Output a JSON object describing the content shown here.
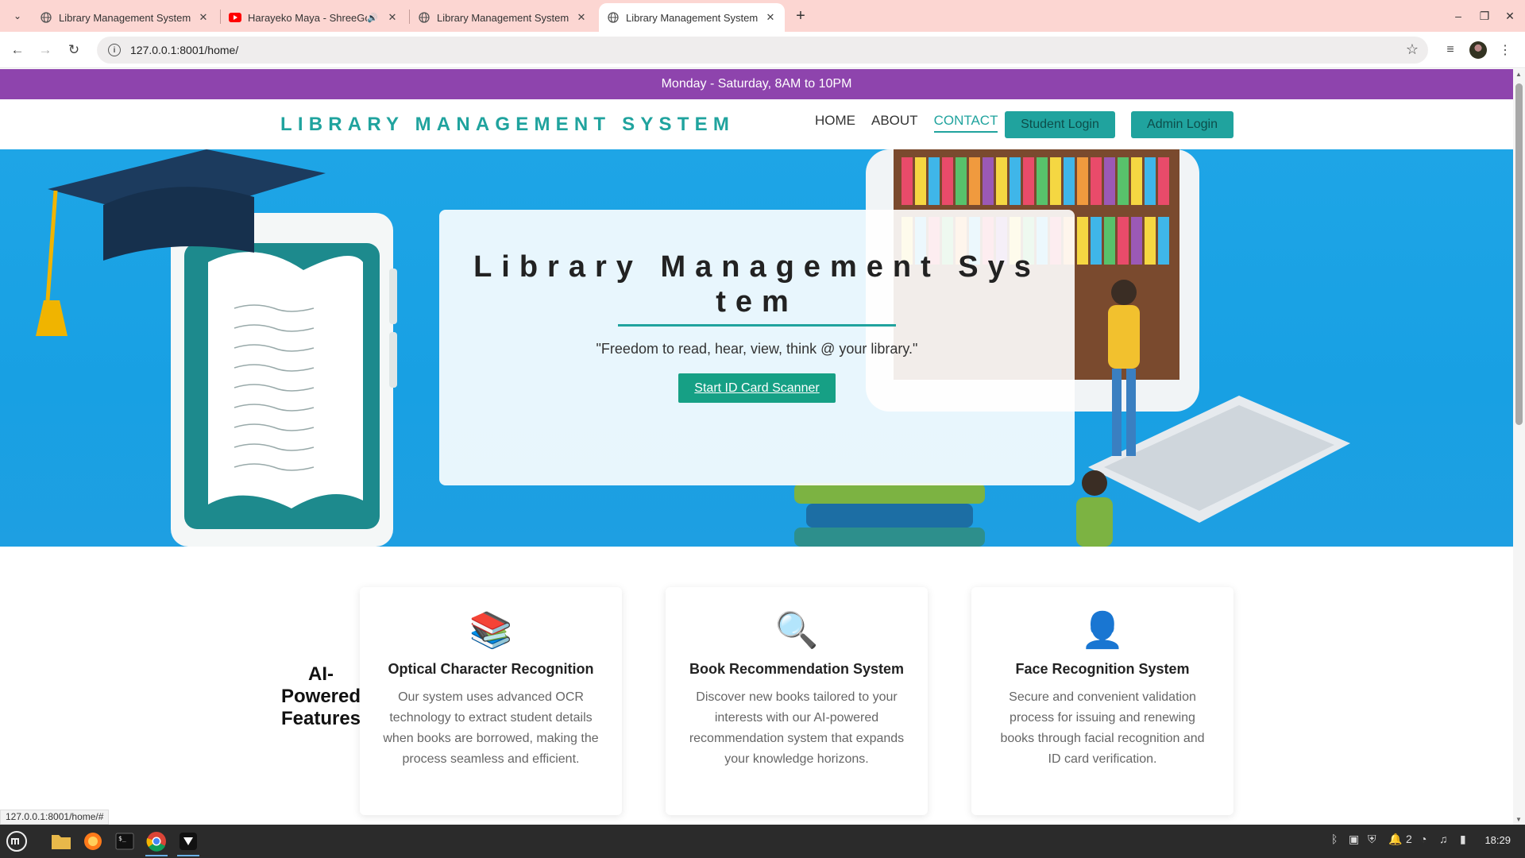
{
  "browser": {
    "tabs": [
      {
        "title": "Library Management System",
        "icon": "globe-icon",
        "active": false
      },
      {
        "title": "Harayeko Maya - ShreeGo",
        "icon": "youtube-icon",
        "audio": true,
        "active": false
      },
      {
        "title": "Library Management System",
        "icon": "globe-icon",
        "active": false
      },
      {
        "title": "Library Management System",
        "icon": "globe-icon",
        "active": true
      }
    ],
    "url": "127.0.0.1:8001/home/",
    "status_url": "127.0.0.1:8001/home/#"
  },
  "site": {
    "hours_banner": "Monday - Saturday, 8AM to 10PM",
    "logo": "LIBRARY MANAGEMENT SYSTEM",
    "nav": {
      "home": "HOME",
      "about": "ABOUT",
      "contact": "CONTACT",
      "student_login": "Student Login",
      "admin_login": "Admin Login"
    },
    "hero": {
      "title": "Library Management System",
      "quote": "\"Freedom to read, hear, view, think @ your library.\"",
      "cta": "Start ID Card Scanner"
    },
    "features": {
      "heading": "AI-Powered Features",
      "cards": [
        {
          "icon": "books-icon",
          "glyph": "📚",
          "title": "Optical Character Recognition",
          "desc": "Our system uses advanced OCR technology to extract student details when books are borrowed, making the process seamless and efficient."
        },
        {
          "icon": "magnifier-icon",
          "glyph": "🔍",
          "title": "Book Recommendation System",
          "desc": "Discover new books tailored to your interests with our AI-powered recommendation system that expands your knowledge horizons."
        },
        {
          "icon": "user-icon",
          "glyph": "👤",
          "title": "Face Recognition System",
          "desc": "Secure and convenient validation process for issuing and renewing books through facial recognition and ID card verification."
        }
      ]
    }
  },
  "taskbar": {
    "clock": "18:29",
    "notification_count": "2"
  },
  "colors": {
    "banner": "#8e44ad",
    "accent": "#20a39e",
    "hero_bg": "#1ea5e6",
    "tabbar": "#fcd6d2"
  }
}
